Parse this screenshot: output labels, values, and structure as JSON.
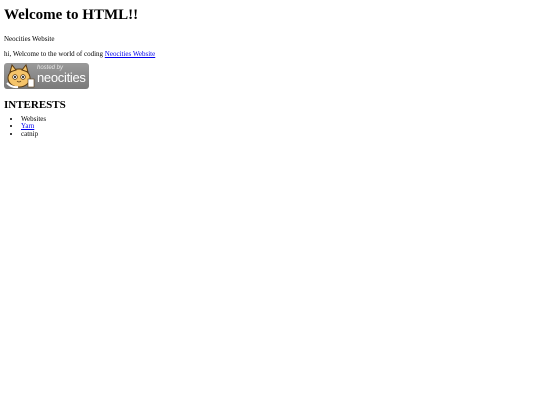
{
  "page": {
    "heading": "Welcome to HTML!!",
    "site_name": "Neocities Website",
    "intro_text": "hi, Welcome to the world of coding",
    "intro_link": "Neocities Website",
    "badge": {
      "hosted_text": "hosted by",
      "brand_text": "neocities"
    },
    "interests_heading": "INTERESTS",
    "interests": [
      {
        "label": "Websites",
        "is_link": false
      },
      {
        "label": "Yarn",
        "is_link": true
      },
      {
        "label": "catnip",
        "is_link": false
      }
    ]
  }
}
